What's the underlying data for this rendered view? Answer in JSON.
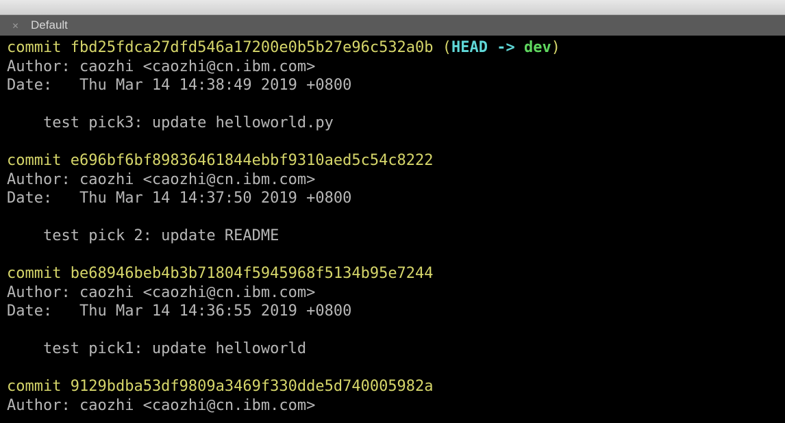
{
  "tab": {
    "label": "Default"
  },
  "log": {
    "commit_word": "commit",
    "author_label": "Author:",
    "date_label": "Date:",
    "head_open": " (",
    "head_word": "HEAD -> ",
    "head_close": ")",
    "branch": "dev",
    "entries": [
      {
        "hash": "fbd25fdca27dfd546a17200e0b5b27e96c532a0b",
        "is_head": true,
        "author": " caozhi <caozhi@cn.ibm.com>",
        "date": "   Thu Mar 14 14:38:49 2019 +0800",
        "message": "    test pick3: update helloworld.py"
      },
      {
        "hash": "e696bf6bf89836461844ebbf9310aed5c54c8222",
        "is_head": false,
        "author": " caozhi <caozhi@cn.ibm.com>",
        "date": "   Thu Mar 14 14:37:50 2019 +0800",
        "message": "    test pick 2: update README"
      },
      {
        "hash": "be68946beb4b3b71804f5945968f5134b95e7244",
        "is_head": false,
        "author": " caozhi <caozhi@cn.ibm.com>",
        "date": "   Thu Mar 14 14:36:55 2019 +0800",
        "message": "    test pick1: update helloworld"
      },
      {
        "hash": "9129bdba53df9809a3469f330dde5d740005982a",
        "is_head": false,
        "author": " caozhi <caozhi@cn.ibm.com>",
        "date": null,
        "message": null
      }
    ]
  }
}
